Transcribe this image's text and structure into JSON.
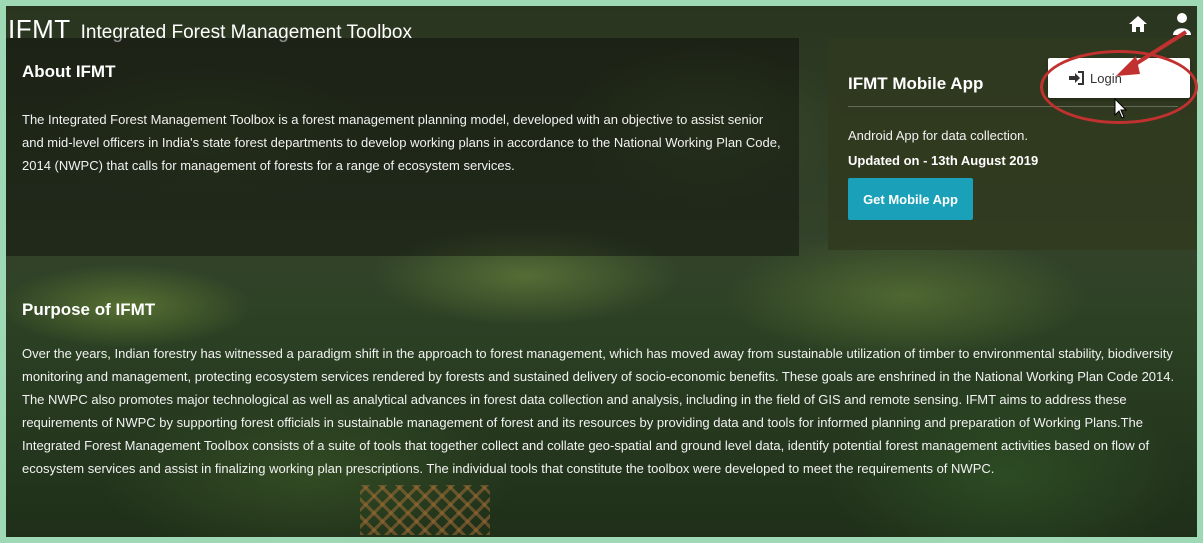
{
  "header": {
    "brand": "IFMT",
    "subtitle": "Integrated Forest Management Toolbox",
    "home_icon": "home-icon",
    "user_icon": "user-icon"
  },
  "about": {
    "heading": "About IFMT",
    "text": "The Integrated Forest Management Toolbox is a forest management planning model, developed with an objective to assist senior and mid-level officers in India's state forest departments to develop working plans in accordance to the National Working Plan Code, 2014 (NWPC) that calls for management of forests for a range of ecosystem services."
  },
  "mobile_app": {
    "heading": "IFMT Mobile App",
    "description": "Android App for data collection.",
    "updated": "Updated on - 13th August 2019",
    "button_label": "Get Mobile App"
  },
  "user_menu": {
    "login_label": "Login",
    "login_icon": "sign-in-icon"
  },
  "purpose": {
    "heading": "Purpose of IFMT",
    "text": "Over the years, Indian forestry has witnessed a paradigm shift in the approach to forest management, which has moved away from sustainable utilization of timber to environmental stability, biodiversity monitoring and management, protecting ecosystem services rendered by forests and sustained delivery of socio-economic benefits. These goals are enshrined in the National Working Plan Code 2014. The NWPC also promotes major technological as well as analytical advances in forest data collection and analysis, including in the field of GIS and remote sensing. IFMT aims to address these requirements of NWPC by supporting forest officials in sustainable management of forest and its resources by providing data and tools for informed planning and preparation of Working Plans.The Integrated Forest Management Toolbox consists of a suite of tools that together collect and collate geo-spatial and ground level data, identify potential forest management activities based on flow of ecosystem services and assist in finalizing working plan prescriptions. The individual tools that constitute the toolbox were developed to meet the requirements of NWPC."
  },
  "colors": {
    "frame": "#9fd8b4",
    "accent_button": "#1aa0b8",
    "annotation": "#c0312f"
  }
}
